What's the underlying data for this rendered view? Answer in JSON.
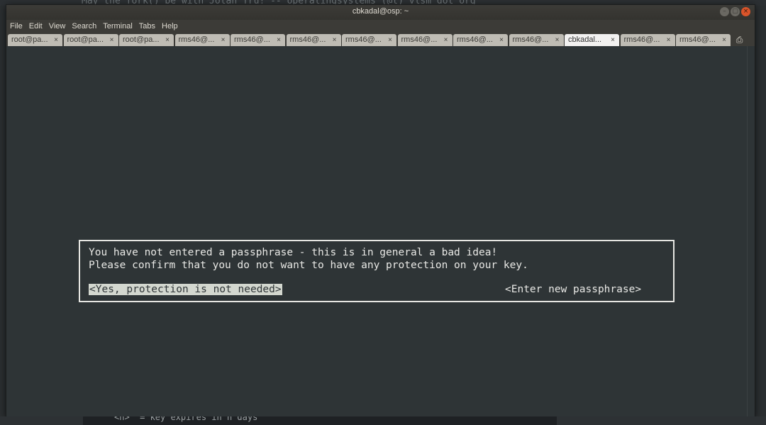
{
  "background": {
    "top_text": "May the fork() be with Jolan Tru! -- operatingsystems (@t) vlsm dot org",
    "bottom_text": "<n>  = key expires in n days"
  },
  "window": {
    "title": "cbkadal@osp: ~",
    "buttons": [
      "–",
      "▢",
      "×"
    ]
  },
  "menu": [
    "File",
    "Edit",
    "View",
    "Search",
    "Terminal",
    "Tabs",
    "Help"
  ],
  "tabs": [
    {
      "label": "root@pa...",
      "active": false
    },
    {
      "label": "root@pa...",
      "active": false
    },
    {
      "label": "root@pa...",
      "active": false
    },
    {
      "label": "rms46@...",
      "active": false
    },
    {
      "label": "rms46@...",
      "active": false
    },
    {
      "label": "rms46@...",
      "active": false
    },
    {
      "label": "rms46@...",
      "active": false
    },
    {
      "label": "rms46@...",
      "active": false
    },
    {
      "label": "rms46@...",
      "active": false
    },
    {
      "label": "rms46@...",
      "active": false
    },
    {
      "label": "cbkadal...",
      "active": true
    },
    {
      "label": "rms46@...",
      "active": false
    },
    {
      "label": "rms46@...",
      "active": false
    }
  ],
  "tab_close_glyph": "×",
  "tab_menu_glyph": "⎙",
  "dialog": {
    "line1": "You have not entered a passphrase - this is in general a bad idea!",
    "line2": "Please confirm that you do not want to have any protection on your key.",
    "option_yes": "<Yes, protection is not needed>",
    "option_enter": "<Enter new passphrase>"
  }
}
